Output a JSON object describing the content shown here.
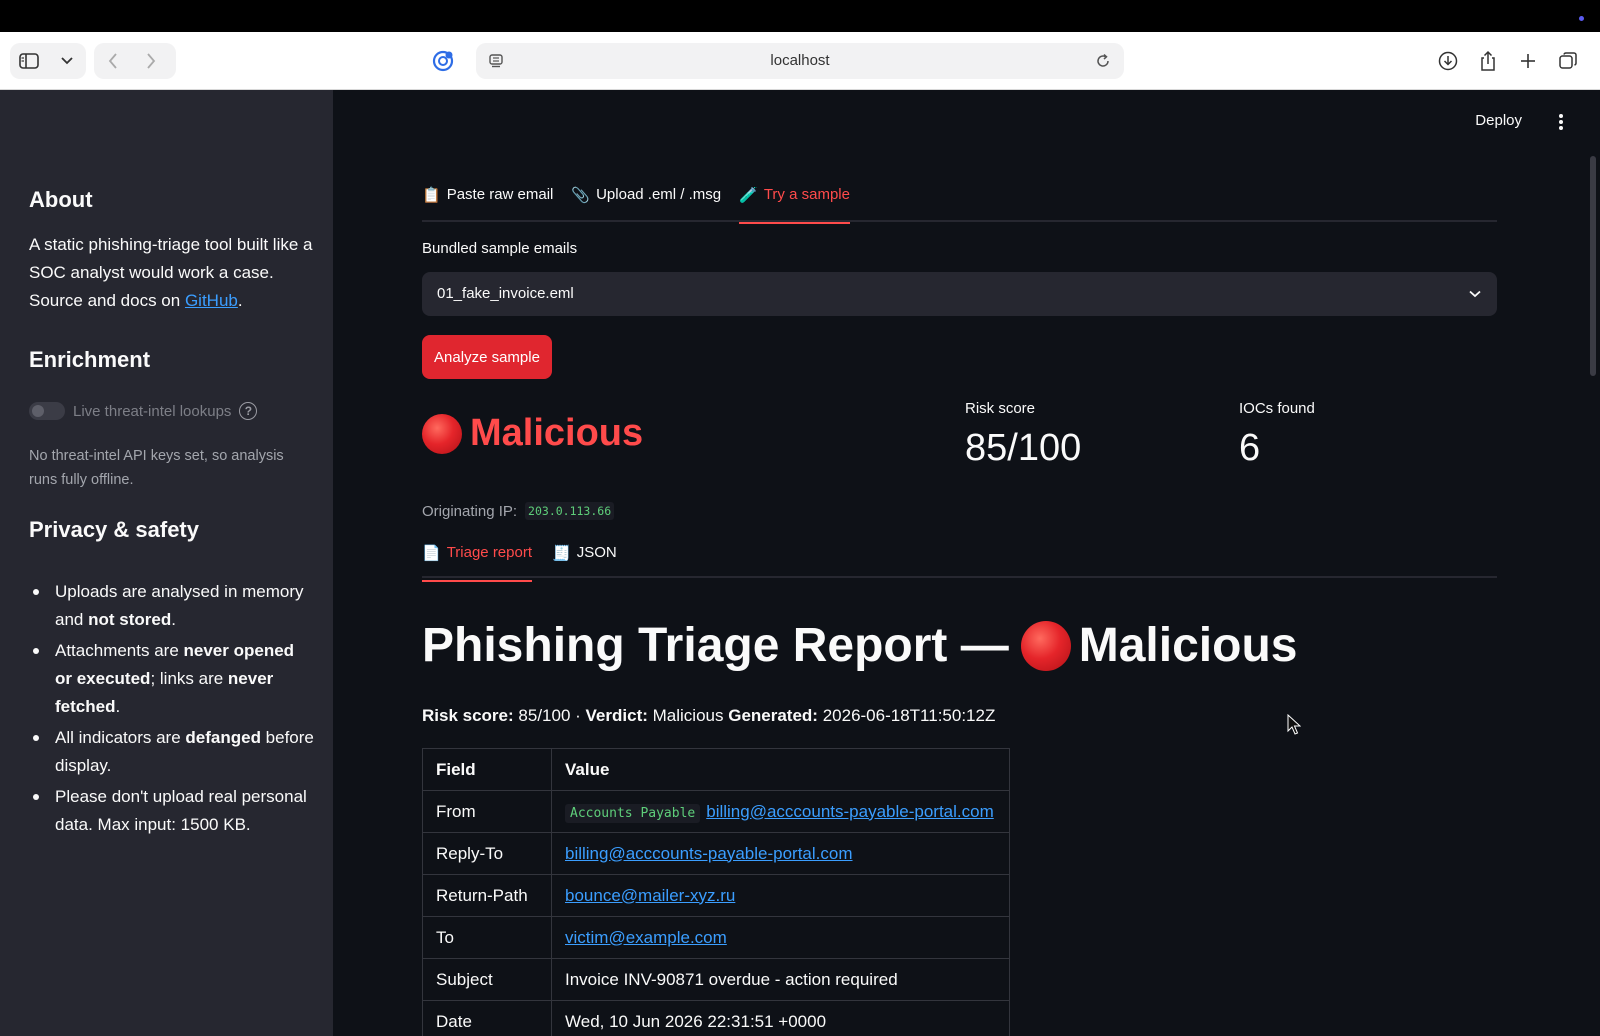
{
  "browser": {
    "url": "localhost"
  },
  "header": {
    "deploy_label": "Deploy"
  },
  "sidebar": {
    "about_title": "About",
    "about_text": "A static phishing-triage tool built like a SOC analyst would work a case. Source and docs on ",
    "about_link": "GitHub",
    "about_suffix": ".",
    "enrichment_title": "Enrichment",
    "toggle_label": "Live threat-intel lookups",
    "toggle_on": false,
    "caption": "No threat-intel API keys set, so analysis runs fully offline.",
    "privacy_title": "Privacy & safety",
    "privacy_items": [
      {
        "a": "Uploads are analysed in memory and ",
        "b": "not stored",
        "c": "."
      },
      {
        "a": "Attachments are ",
        "b": "never opened or executed",
        "c": "; links are ",
        "d": "never fetched",
        "e": "."
      },
      {
        "a": "All indicators are ",
        "b": "defanged",
        "c": " before display."
      },
      {
        "a": "Please don't upload real personal data. Max input: 1500 KB."
      }
    ]
  },
  "input_tabs": [
    {
      "icon": "📋",
      "label": "Paste raw email",
      "active": false
    },
    {
      "icon": "📎",
      "label": "Upload .eml / .msg",
      "active": false
    },
    {
      "icon": "🧪",
      "label": "Try a sample",
      "active": true
    }
  ],
  "sample_select": {
    "label": "Bundled sample emails",
    "value": "01_fake_invoice.eml"
  },
  "analyze_button": "Analyze sample",
  "result": {
    "verdict": "Malicious",
    "risk_label": "Risk score",
    "risk_value": "85/100",
    "iocs_label": "IOCs found",
    "iocs_value": "6",
    "origin_label": "Originating IP:",
    "origin_ip": "203.0.113.66"
  },
  "report_tabs": [
    {
      "icon": "📄",
      "label": "Triage report",
      "active": true
    },
    {
      "icon": "🧾",
      "label": "JSON",
      "active": false
    }
  ],
  "report": {
    "title": "Phishing Triage Report —",
    "title_verdict": "Malicious",
    "risk_key": "Risk score:",
    "risk_val": "85/100 ·",
    "verdict_key": "Verdict:",
    "verdict_val": "Malicious",
    "generated_key": "Generated:",
    "generated_val": "2026-06-18T11:50:12Z",
    "table": {
      "headers": [
        "Field",
        "Value"
      ],
      "rows": [
        {
          "field": "From",
          "code": "Accounts Payable",
          "link": "billing@acccounts-payable-portal.com"
        },
        {
          "field": "Reply-To",
          "link": "billing@acccounts-payable-portal.com"
        },
        {
          "field": "Return-Path",
          "link": "bounce@mailer-xyz.ru"
        },
        {
          "field": "To",
          "link": "victim@example.com"
        },
        {
          "field": "Subject",
          "text": "Invoice INV-90871 overdue - action required"
        },
        {
          "field": "Date",
          "text": "Wed, 10 Jun 2026 22:31:51 +0000"
        }
      ]
    }
  },
  "colors": {
    "accent": "#ff4b4b",
    "button": "#e0262f",
    "link": "#3b9eff",
    "code": "#5ece7a"
  }
}
